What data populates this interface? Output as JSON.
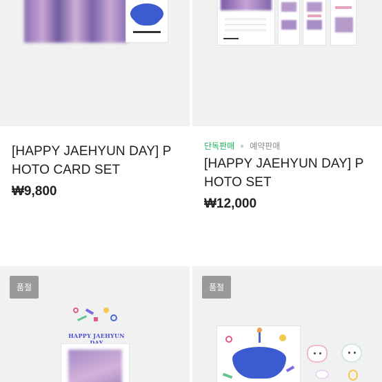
{
  "products": [
    {
      "title": "[HAPPY JAEHYUN DAY] PHOTO CARD SET",
      "title_lines": [
        "[HAPPY JAEHYUN DAY] P",
        "HOTO CARD SET"
      ],
      "price": "₩9,800",
      "tags": [],
      "sold_out": false
    },
    {
      "title": "[HAPPY JAEHYUN DAY] PHOTO SET",
      "title_lines": [
        "[HAPPY JAEHYUN DAY] P",
        "HOTO SET"
      ],
      "price": "₩12,000",
      "tags": [
        {
          "label": "단독판매",
          "color": "#19b35a"
        },
        {
          "label": "예약판매",
          "color": "#8a8a8a"
        }
      ],
      "sold_out": false
    },
    {
      "sold_out": true,
      "sold_out_label": "품절",
      "image_text": "HAPPY JAEHYUN DAY"
    },
    {
      "sold_out": true,
      "sold_out_label": "품절"
    }
  ]
}
